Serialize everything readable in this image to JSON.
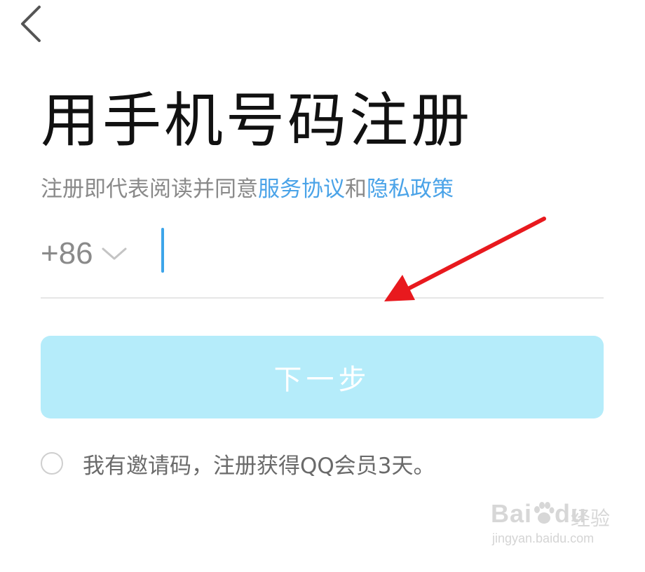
{
  "title": "用手机号码注册",
  "agreement": {
    "prefix": "注册即代表阅读并同意",
    "service_link": "服务协议",
    "conjunction": "和",
    "privacy_link": "隐私政策"
  },
  "phone": {
    "country_code": "+86",
    "value": "",
    "placeholder": ""
  },
  "next_button_label": "下一步",
  "invite": {
    "checked": false,
    "label": "我有邀请码，注册获得QQ会员3天。"
  },
  "watermark": {
    "logo_text_1": "Bai",
    "logo_text_2": "du",
    "brand_cn": "经验",
    "url": "jingyan.baidu.com"
  },
  "icons": {
    "back": "chevron-left-icon",
    "country_dropdown": "chevron-down-icon",
    "annotation": "red-arrow-icon"
  },
  "colors": {
    "link": "#4aa3e8",
    "caret": "#3da5ea",
    "button_bg": "#b5ecfa",
    "annotation_arrow": "#e8191e"
  }
}
